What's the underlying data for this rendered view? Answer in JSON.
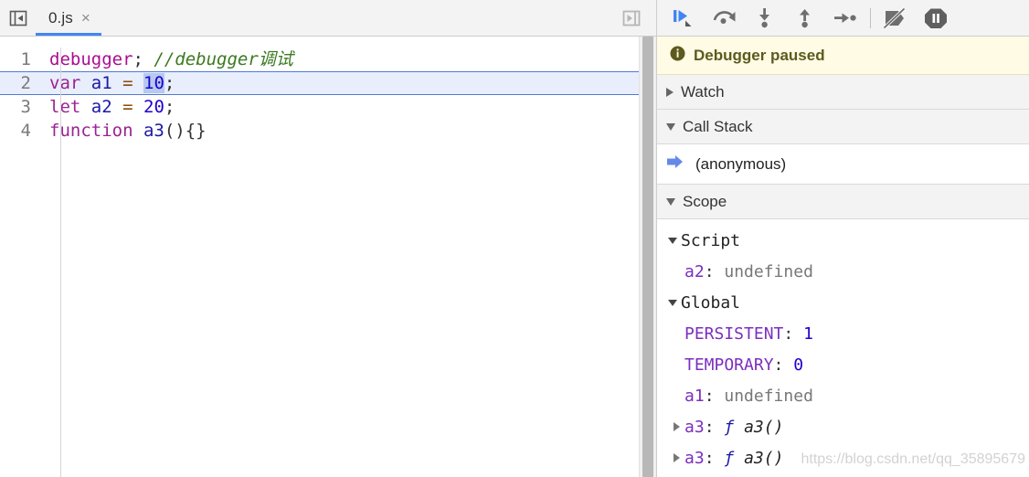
{
  "sources": {
    "nav_toggle_title": "Show navigator",
    "tabs": [
      {
        "label": "0.js",
        "close": "×",
        "active": true
      }
    ],
    "panel_toggle_title": "Show panel",
    "code_lines": [
      {
        "num": "1",
        "tokens": [
          {
            "text": "debugger",
            "cls": "tok-kw"
          },
          {
            "text": ";",
            "cls": "tok-punct"
          },
          {
            "text": " ",
            "cls": "tok-punct"
          },
          {
            "text": "//debugger调试",
            "cls": "tok-comment"
          }
        ]
      },
      {
        "num": "2",
        "highlight": true,
        "tokens": [
          {
            "text": "var",
            "cls": "tok-kw2"
          },
          {
            "text": " ",
            "cls": "tok-punct"
          },
          {
            "text": "a1",
            "cls": "tok-var"
          },
          {
            "text": " ",
            "cls": "tok-punct"
          },
          {
            "text": "=",
            "cls": "tok-op"
          },
          {
            "text": " ",
            "cls": "tok-punct"
          },
          {
            "text": "10",
            "cls": "sel",
            "caret_before": true
          },
          {
            "text": ";",
            "cls": "tok-punct"
          }
        ]
      },
      {
        "num": "3",
        "tokens": [
          {
            "text": "let",
            "cls": "tok-kw2"
          },
          {
            "text": " ",
            "cls": "tok-punct"
          },
          {
            "text": "a2",
            "cls": "tok-var"
          },
          {
            "text": " ",
            "cls": "tok-punct"
          },
          {
            "text": "=",
            "cls": "tok-op"
          },
          {
            "text": " ",
            "cls": "tok-punct"
          },
          {
            "text": "20",
            "cls": "tok-num"
          },
          {
            "text": ";",
            "cls": "tok-punct"
          }
        ]
      },
      {
        "num": "4",
        "tokens": [
          {
            "text": "function",
            "cls": "tok-kw2"
          },
          {
            "text": " ",
            "cls": "tok-punct"
          },
          {
            "text": "a3",
            "cls": "tok-fnname"
          },
          {
            "text": "(){}",
            "cls": "tok-punct"
          }
        ]
      }
    ]
  },
  "debugger": {
    "toolbar": [
      {
        "name": "resume-button",
        "title": "Resume script execution",
        "icon": "resume-icon",
        "accent": "#4285f4"
      },
      {
        "name": "step-over-button",
        "title": "Step over next function call",
        "icon": "step-over-icon",
        "accent": "#6e6e6e"
      },
      {
        "name": "step-into-button",
        "title": "Step into next function call",
        "icon": "step-into-icon",
        "accent": "#6e6e6e"
      },
      {
        "name": "step-out-button",
        "title": "Step out of current function",
        "icon": "step-out-icon",
        "accent": "#6e6e6e"
      },
      {
        "name": "step-button",
        "title": "Step",
        "icon": "step-icon",
        "accent": "#6e6e6e"
      },
      {
        "name": "deactivate-breakpoints-button",
        "title": "Deactivate breakpoints",
        "icon": "deactivate-breakpoints-icon",
        "accent": "#6e6e6e"
      },
      {
        "name": "pause-on-exceptions-button",
        "title": "Pause on exceptions",
        "icon": "pause-on-exceptions-icon",
        "accent": "#5f5f5f"
      }
    ],
    "paused_banner": {
      "icon": "info-icon",
      "text": "Debugger paused",
      "bg": "#fffbe5",
      "fg": "#5c5a1e"
    },
    "sections": [
      {
        "name": "watch",
        "label": "Watch",
        "expanded": false
      },
      {
        "name": "call-stack",
        "label": "Call Stack",
        "expanded": true
      },
      {
        "name": "scope",
        "label": "Scope",
        "expanded": true
      }
    ],
    "call_stack": [
      {
        "label": "(anonymous)",
        "active": true,
        "icon": "active-frame-arrow-icon"
      }
    ],
    "scope": [
      {
        "kind": "group",
        "label": "Script",
        "expanded": true
      },
      {
        "kind": "prop",
        "name": "a2",
        "value": "undefined",
        "value_type": "undefined"
      },
      {
        "kind": "group",
        "label": "Global",
        "expanded": true
      },
      {
        "kind": "prop",
        "name": "PERSISTENT",
        "value": "1",
        "value_type": "number"
      },
      {
        "kind": "prop",
        "name": "TEMPORARY",
        "value": "0",
        "value_type": "number"
      },
      {
        "kind": "prop",
        "name": "a1",
        "value": "undefined",
        "value_type": "undefined"
      },
      {
        "kind": "prop-expandable",
        "name": "a3",
        "fn_symbol": "ƒ",
        "value": "a3()",
        "value_type": "function",
        "expanded": false
      },
      {
        "kind": "prop-expandable",
        "name": "a3",
        "fn_symbol": "ƒ",
        "value": "a3()",
        "value_type": "function",
        "expanded": false,
        "clipped": true
      }
    ]
  },
  "watermark": "https://blog.csdn.net/qq_35895679",
  "colors": {
    "accent_blue": "#4285f4",
    "toolbar_bg": "#f3f3f3",
    "paused_bg": "#fffbe5",
    "highlight_line": "#e8eefc",
    "highlight_border": "#5079d4",
    "selection": "#b6c9ef"
  }
}
